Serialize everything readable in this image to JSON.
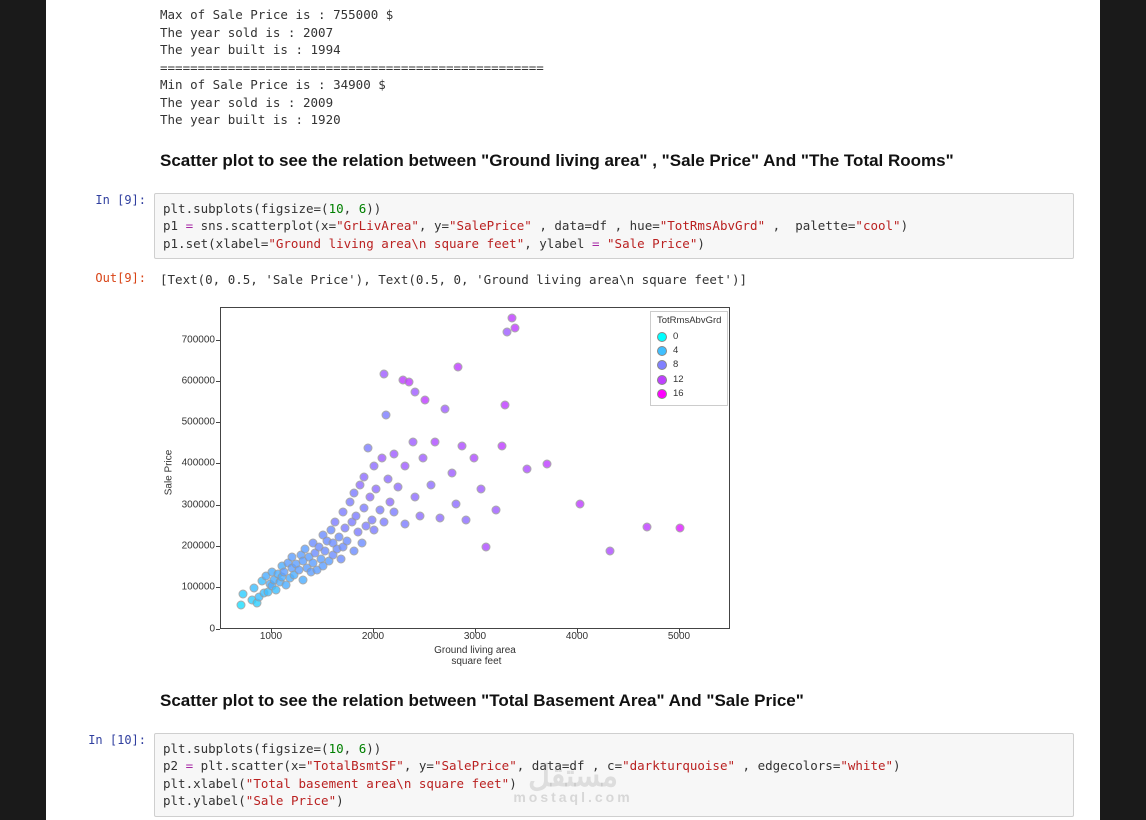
{
  "output1": {
    "lines": [
      "Max of Sale Price is : 755000 $",
      "The year sold is : 2007",
      "The year built is : 1994",
      "===================================================",
      "Min of Sale Price is : 34900 $",
      "The year sold is : 2009",
      "The year built is : 1920"
    ]
  },
  "heading1": "Scatter plot to see the relation between \"Ground living area\" , \"Sale Price\" And \"The Total Rooms\"",
  "prompts": {
    "in9": "In [9]:",
    "out9": "Out[9]:",
    "in10": "In [10]:"
  },
  "code9": {
    "raw": "plt.subplots(figsize=(10, 6))\np1 = sns.scatterplot(x=\"GrLivArea\", y=\"SalePrice\" , data=df , hue=\"TotRmsAbvGrd\" ,  palette=\"cool\")\np1.set(xlabel=\"Ground living area\\n square feet\", ylabel = \"Sale Price\")"
  },
  "output9_repr": "[Text(0, 0.5, 'Sale Price'), Text(0.5, 0, 'Ground living area\\n square feet')]",
  "chart_data": {
    "type": "scatter",
    "xlabel": "Ground living area\n square feet",
    "ylabel": "Sale Price",
    "xlim": [
      500,
      5500
    ],
    "ylim": [
      0,
      780000
    ],
    "xticks": [
      1000,
      2000,
      3000,
      4000,
      5000
    ],
    "yticks": [
      0,
      100000,
      200000,
      300000,
      400000,
      500000,
      600000,
      700000
    ],
    "hue_label": "TotRmsAbvGrd",
    "hue_ticks": [
      0,
      4,
      8,
      12,
      16
    ],
    "hue_colors": [
      "#00ffff",
      "#40bfff",
      "#8080ff",
      "#bf40ff",
      "#ff00ff"
    ],
    "series": [
      {
        "x": 700,
        "y": 60000,
        "hue": 2
      },
      {
        "x": 720,
        "y": 85000,
        "hue": 3
      },
      {
        "x": 800,
        "y": 72000,
        "hue": 3
      },
      {
        "x": 820,
        "y": 100000,
        "hue": 4
      },
      {
        "x": 850,
        "y": 65000,
        "hue": 3
      },
      {
        "x": 870,
        "y": 78000,
        "hue": 4
      },
      {
        "x": 900,
        "y": 118000,
        "hue": 4
      },
      {
        "x": 920,
        "y": 88000,
        "hue": 4
      },
      {
        "x": 940,
        "y": 130000,
        "hue": 5
      },
      {
        "x": 960,
        "y": 92000,
        "hue": 4
      },
      {
        "x": 980,
        "y": 110000,
        "hue": 5
      },
      {
        "x": 1000,
        "y": 105000,
        "hue": 5
      },
      {
        "x": 1000,
        "y": 140000,
        "hue": 5
      },
      {
        "x": 1020,
        "y": 120000,
        "hue": 5
      },
      {
        "x": 1040,
        "y": 95000,
        "hue": 4
      },
      {
        "x": 1060,
        "y": 135000,
        "hue": 5
      },
      {
        "x": 1080,
        "y": 115000,
        "hue": 5
      },
      {
        "x": 1100,
        "y": 155000,
        "hue": 5
      },
      {
        "x": 1100,
        "y": 128000,
        "hue": 5
      },
      {
        "x": 1120,
        "y": 140000,
        "hue": 6
      },
      {
        "x": 1140,
        "y": 108000,
        "hue": 5
      },
      {
        "x": 1160,
        "y": 162000,
        "hue": 6
      },
      {
        "x": 1180,
        "y": 125000,
        "hue": 5
      },
      {
        "x": 1200,
        "y": 148000,
        "hue": 6
      },
      {
        "x": 1200,
        "y": 175000,
        "hue": 6
      },
      {
        "x": 1220,
        "y": 132000,
        "hue": 5
      },
      {
        "x": 1240,
        "y": 158000,
        "hue": 6
      },
      {
        "x": 1260,
        "y": 145000,
        "hue": 6
      },
      {
        "x": 1280,
        "y": 180000,
        "hue": 6
      },
      {
        "x": 1300,
        "y": 120000,
        "hue": 5
      },
      {
        "x": 1300,
        "y": 165000,
        "hue": 6
      },
      {
        "x": 1320,
        "y": 195000,
        "hue": 6
      },
      {
        "x": 1340,
        "y": 150000,
        "hue": 6
      },
      {
        "x": 1360,
        "y": 175000,
        "hue": 6
      },
      {
        "x": 1380,
        "y": 140000,
        "hue": 6
      },
      {
        "x": 1400,
        "y": 210000,
        "hue": 7
      },
      {
        "x": 1400,
        "y": 160000,
        "hue": 6
      },
      {
        "x": 1420,
        "y": 185000,
        "hue": 7
      },
      {
        "x": 1440,
        "y": 145000,
        "hue": 6
      },
      {
        "x": 1460,
        "y": 200000,
        "hue": 7
      },
      {
        "x": 1480,
        "y": 170000,
        "hue": 6
      },
      {
        "x": 1500,
        "y": 230000,
        "hue": 7
      },
      {
        "x": 1500,
        "y": 155000,
        "hue": 6
      },
      {
        "x": 1520,
        "y": 190000,
        "hue": 7
      },
      {
        "x": 1540,
        "y": 215000,
        "hue": 7
      },
      {
        "x": 1560,
        "y": 165000,
        "hue": 6
      },
      {
        "x": 1580,
        "y": 240000,
        "hue": 7
      },
      {
        "x": 1600,
        "y": 180000,
        "hue": 7
      },
      {
        "x": 1600,
        "y": 210000,
        "hue": 7
      },
      {
        "x": 1620,
        "y": 260000,
        "hue": 8
      },
      {
        "x": 1640,
        "y": 195000,
        "hue": 7
      },
      {
        "x": 1660,
        "y": 225000,
        "hue": 7
      },
      {
        "x": 1680,
        "y": 170000,
        "hue": 7
      },
      {
        "x": 1700,
        "y": 285000,
        "hue": 8
      },
      {
        "x": 1700,
        "y": 200000,
        "hue": 7
      },
      {
        "x": 1720,
        "y": 245000,
        "hue": 8
      },
      {
        "x": 1740,
        "y": 215000,
        "hue": 7
      },
      {
        "x": 1760,
        "y": 310000,
        "hue": 8
      },
      {
        "x": 1780,
        "y": 260000,
        "hue": 8
      },
      {
        "x": 1800,
        "y": 190000,
        "hue": 7
      },
      {
        "x": 1800,
        "y": 330000,
        "hue": 8
      },
      {
        "x": 1820,
        "y": 275000,
        "hue": 8
      },
      {
        "x": 1840,
        "y": 235000,
        "hue": 8
      },
      {
        "x": 1860,
        "y": 350000,
        "hue": 9
      },
      {
        "x": 1880,
        "y": 210000,
        "hue": 7
      },
      {
        "x": 1900,
        "y": 295000,
        "hue": 8
      },
      {
        "x": 1900,
        "y": 370000,
        "hue": 9
      },
      {
        "x": 1920,
        "y": 250000,
        "hue": 8
      },
      {
        "x": 1940,
        "y": 440000,
        "hue": 8
      },
      {
        "x": 1960,
        "y": 320000,
        "hue": 9
      },
      {
        "x": 1980,
        "y": 265000,
        "hue": 8
      },
      {
        "x": 2000,
        "y": 395000,
        "hue": 9
      },
      {
        "x": 2000,
        "y": 240000,
        "hue": 8
      },
      {
        "x": 2020,
        "y": 340000,
        "hue": 9
      },
      {
        "x": 2060,
        "y": 290000,
        "hue": 8
      },
      {
        "x": 2080,
        "y": 415000,
        "hue": 10
      },
      {
        "x": 2100,
        "y": 260000,
        "hue": 8
      },
      {
        "x": 2100,
        "y": 620000,
        "hue": 10
      },
      {
        "x": 2120,
        "y": 520000,
        "hue": 8
      },
      {
        "x": 2140,
        "y": 365000,
        "hue": 9
      },
      {
        "x": 2160,
        "y": 310000,
        "hue": 9
      },
      {
        "x": 2200,
        "y": 285000,
        "hue": 8
      },
      {
        "x": 2200,
        "y": 425000,
        "hue": 10
      },
      {
        "x": 2240,
        "y": 345000,
        "hue": 9
      },
      {
        "x": 2280,
        "y": 605000,
        "hue": 12
      },
      {
        "x": 2300,
        "y": 395000,
        "hue": 10
      },
      {
        "x": 2300,
        "y": 255000,
        "hue": 8
      },
      {
        "x": 2340,
        "y": 600000,
        "hue": 12
      },
      {
        "x": 2380,
        "y": 455000,
        "hue": 10
      },
      {
        "x": 2400,
        "y": 320000,
        "hue": 9
      },
      {
        "x": 2400,
        "y": 575000,
        "hue": 10
      },
      {
        "x": 2450,
        "y": 275000,
        "hue": 9
      },
      {
        "x": 2480,
        "y": 415000,
        "hue": 10
      },
      {
        "x": 2500,
        "y": 555000,
        "hue": 12
      },
      {
        "x": 2560,
        "y": 350000,
        "hue": 9
      },
      {
        "x": 2600,
        "y": 455000,
        "hue": 11
      },
      {
        "x": 2650,
        "y": 270000,
        "hue": 9
      },
      {
        "x": 2700,
        "y": 535000,
        "hue": 10
      },
      {
        "x": 2760,
        "y": 380000,
        "hue": 10
      },
      {
        "x": 2800,
        "y": 305000,
        "hue": 9
      },
      {
        "x": 2820,
        "y": 635000,
        "hue": 12
      },
      {
        "x": 2860,
        "y": 445000,
        "hue": 11
      },
      {
        "x": 2900,
        "y": 265000,
        "hue": 9
      },
      {
        "x": 2980,
        "y": 415000,
        "hue": 11
      },
      {
        "x": 3050,
        "y": 340000,
        "hue": 10
      },
      {
        "x": 3100,
        "y": 200000,
        "hue": 11
      },
      {
        "x": 3200,
        "y": 290000,
        "hue": 10
      },
      {
        "x": 3250,
        "y": 445000,
        "hue": 12
      },
      {
        "x": 3280,
        "y": 545000,
        "hue": 12
      },
      {
        "x": 3300,
        "y": 720000,
        "hue": 10
      },
      {
        "x": 3350,
        "y": 755000,
        "hue": 12
      },
      {
        "x": 3380,
        "y": 730000,
        "hue": 12
      },
      {
        "x": 3500,
        "y": 390000,
        "hue": 11
      },
      {
        "x": 3700,
        "y": 400000,
        "hue": 12
      },
      {
        "x": 4020,
        "y": 305000,
        "hue": 12
      },
      {
        "x": 4316,
        "y": 190000,
        "hue": 11
      },
      {
        "x": 4680,
        "y": 248000,
        "hue": 12
      },
      {
        "x": 5000,
        "y": 245000,
        "hue": 14
      }
    ]
  },
  "heading2": "Scatter plot to see the relation between \"Total Basement Area\" And \"Sale Price\"",
  "code10": {
    "raw": "plt.subplots(figsize=(10, 6))\np2 = plt.scatter(x=\"TotalBsmtSF\", y=\"SalePrice\", data=df , c=\"darkturquoise\" , edgecolors=\"white\")\nplt.xlabel(\"Total basement area\\n square feet\")\nplt.ylabel(\"Sale Price\")"
  },
  "watermark": {
    "logo": "مستقل",
    "text": "mostaql.com"
  }
}
